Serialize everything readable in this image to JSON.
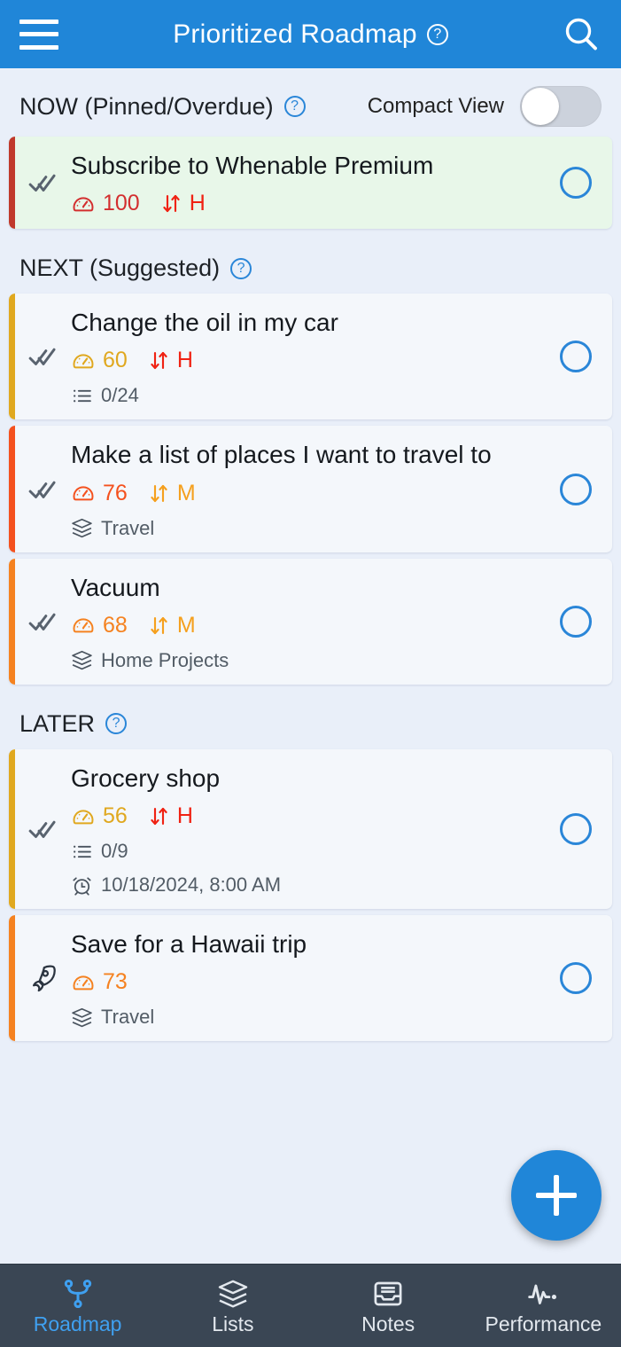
{
  "appbar": {
    "menu_icon": "hamburger-menu-icon",
    "title": "Prioritized Roadmap",
    "title_help_icon": "help-circle-icon",
    "search_icon": "search-icon"
  },
  "toolbar": {
    "compact_view_label": "Compact View",
    "compact_view_on": false
  },
  "sections": [
    {
      "id": "now",
      "title": "NOW (Pinned/Overdue)",
      "help_icon": "help-circle-icon",
      "tasks": [
        {
          "title": "Subscribe to Whenable Premium",
          "accent_color": "#c0392b",
          "card_background": "#e8f7e9",
          "left_icon": "double-check-icon",
          "score": "100",
          "score_color": "#d32f2f",
          "score_icon": "gauge-icon",
          "priority": "H",
          "priority_color": "#f02213",
          "priority_icon": "priority-arrows-icon",
          "complete_circle_color": "#2a86d8",
          "sub_meta": []
        }
      ]
    },
    {
      "id": "next",
      "title": "NEXT (Suggested)",
      "help_icon": "help-circle-icon",
      "tasks": [
        {
          "title": "Change the oil in my car",
          "accent_color": "#e0a81f",
          "card_background": "#f4f7fb",
          "left_icon": "double-check-icon",
          "score": "60",
          "score_color": "#e0a81f",
          "score_icon": "gauge-icon",
          "priority": "H",
          "priority_color": "#f02213",
          "priority_icon": "priority-arrows-icon",
          "complete_circle_color": "#2a86d8",
          "sub_meta": [
            {
              "icon": "checklist-icon",
              "text": "0/24"
            }
          ]
        },
        {
          "title": "Make a list of places I want to travel to",
          "accent_color": "#f4511e",
          "card_background": "#f4f7fb",
          "left_icon": "double-check-icon",
          "score": "76",
          "score_color": "#f4511e",
          "score_icon": "gauge-icon",
          "priority": "M",
          "priority_color": "#f5a01e",
          "priority_icon": "priority-arrows-icon",
          "complete_circle_color": "#2a86d8",
          "sub_meta": [
            {
              "icon": "stack-icon",
              "text": "Travel"
            }
          ]
        },
        {
          "title": "Vacuum",
          "accent_color": "#f58220",
          "card_background": "#f4f7fb",
          "left_icon": "double-check-icon",
          "score": "68",
          "score_color": "#f58220",
          "score_icon": "gauge-icon",
          "priority": "M",
          "priority_color": "#f5a01e",
          "priority_icon": "priority-arrows-icon",
          "complete_circle_color": "#2a86d8",
          "sub_meta": [
            {
              "icon": "stack-icon",
              "text": "Home Projects"
            }
          ]
        }
      ]
    },
    {
      "id": "later",
      "title": "LATER",
      "help_icon": "help-circle-icon",
      "tasks": [
        {
          "title": "Grocery shop",
          "accent_color": "#e0a81f",
          "card_background": "#f4f7fb",
          "left_icon": "double-check-icon",
          "score": "56",
          "score_color": "#e0a81f",
          "score_icon": "gauge-icon",
          "priority": "H",
          "priority_color": "#f02213",
          "priority_icon": "priority-arrows-icon",
          "complete_circle_color": "#2a86d8",
          "sub_meta": [
            {
              "icon": "checklist-icon",
              "text": "0/9"
            },
            {
              "icon": "alarm-clock-icon",
              "text": "10/18/2024, 8:00 AM"
            }
          ]
        },
        {
          "title": "Save for a Hawaii trip",
          "accent_color": "#f58220",
          "card_background": "#f4f7fb",
          "left_icon": "rocket-icon",
          "score": "73",
          "score_color": "#f58220",
          "score_icon": "gauge-icon",
          "priority": "",
          "priority_color": "",
          "priority_icon": "",
          "complete_circle_color": "#2a86d8",
          "sub_meta": [
            {
              "icon": "stack-icon",
              "text": "Travel"
            }
          ]
        }
      ]
    }
  ],
  "fab": {
    "icon": "plus-icon",
    "color": "#2086d8"
  },
  "bottom_nav": {
    "active": "Roadmap",
    "active_color": "#3fa0f0",
    "items": [
      {
        "label": "Roadmap",
        "icon": "roadmap-fork-icon",
        "active": true
      },
      {
        "label": "Lists",
        "icon": "stack-icon",
        "active": false
      },
      {
        "label": "Notes",
        "icon": "inbox-notes-icon",
        "active": false
      },
      {
        "label": "Performance",
        "icon": "pulse-activity-icon",
        "active": false
      }
    ]
  }
}
